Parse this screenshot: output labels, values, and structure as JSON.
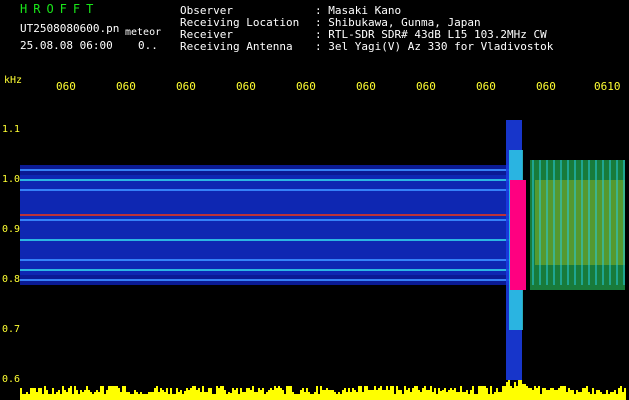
{
  "header": {
    "brand": "HROFFT",
    "filename": "UT2508080600.pn",
    "file_suffix": "meteor",
    "datetime": "25.08.08 06:00",
    "datetime_extra": "0..",
    "info": [
      {
        "label": "Observer",
        "value": ": Masaki Kano"
      },
      {
        "label": "Receiving Location",
        "value": ": Shibukawa, Gunma, Japan"
      },
      {
        "label": "Receiver",
        "value": ": RTL-SDR SDR# 43dB L15 103.2MHz CW"
      },
      {
        "label": "Receiving Antenna",
        "value": ": 3el Yagi(V) Az 330 for Vladivostok"
      }
    ]
  },
  "axes": {
    "y_unit": "kHz",
    "y_ticks": [
      "1.1",
      "1.0",
      "0.9",
      "0.8",
      "0.7",
      "0.6"
    ],
    "x_ticks": [
      "060",
      "060",
      "060",
      "060",
      "060",
      "060",
      "060",
      "060",
      "060",
      "0610"
    ]
  },
  "chart_data": {
    "type": "heatmap",
    "ylabel": "kHz",
    "ylim": [
      0.6,
      1.1
    ],
    "y_ticks": [
      1.1,
      1.0,
      0.9,
      0.8,
      0.7,
      0.6
    ],
    "x_ticks": [
      "060",
      "060",
      "060",
      "060",
      "060",
      "060",
      "060",
      "060",
      "060",
      "0610"
    ],
    "noise_band_khz": [
      0.79,
      1.03
    ],
    "steady_lines_khz": [
      1.02,
      1.0,
      0.98,
      0.93,
      0.92,
      0.88,
      0.84,
      0.82,
      0.8
    ],
    "meteor_event": {
      "freq_range_khz": [
        0.6,
        1.12
      ],
      "peak_khz": [
        0.78,
        1.0
      ]
    },
    "colors": {
      "background": "#000000",
      "axis_text": "#ffff33",
      "brand": "#19e619",
      "peak": "#ff0080",
      "level_bars": "#ffff00"
    }
  }
}
